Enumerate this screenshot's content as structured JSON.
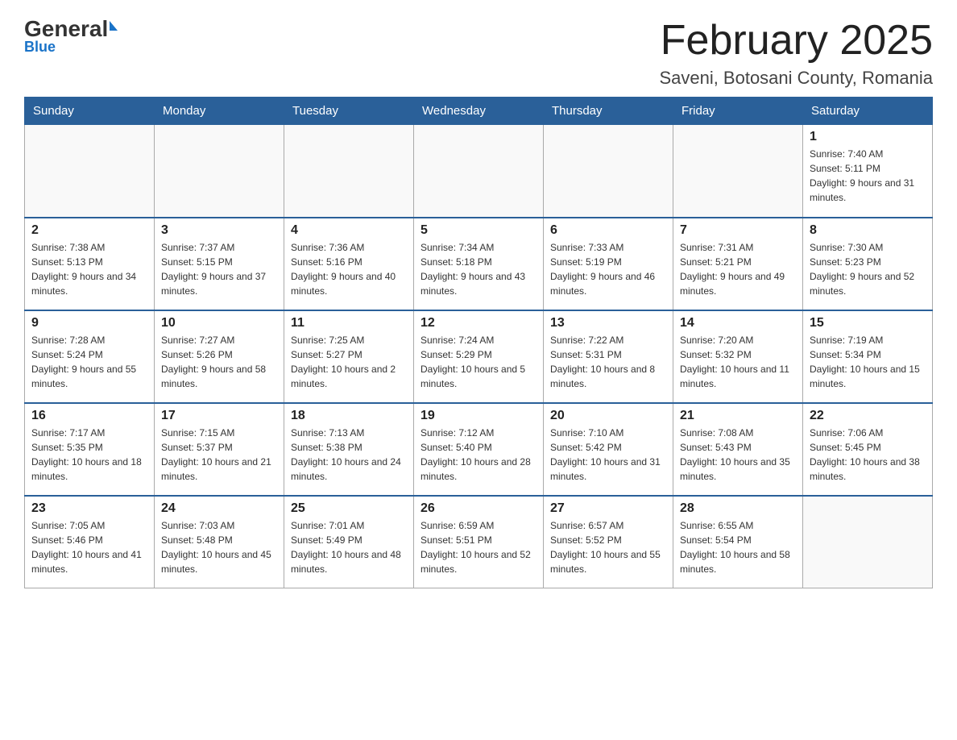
{
  "header": {
    "logo_main": "General",
    "logo_blue": "Blue",
    "month_title": "February 2025",
    "location": "Saveni, Botosani County, Romania"
  },
  "weekdays": [
    "Sunday",
    "Monday",
    "Tuesday",
    "Wednesday",
    "Thursday",
    "Friday",
    "Saturday"
  ],
  "weeks": [
    [
      {
        "day": "",
        "info": ""
      },
      {
        "day": "",
        "info": ""
      },
      {
        "day": "",
        "info": ""
      },
      {
        "day": "",
        "info": ""
      },
      {
        "day": "",
        "info": ""
      },
      {
        "day": "",
        "info": ""
      },
      {
        "day": "1",
        "info": "Sunrise: 7:40 AM\nSunset: 5:11 PM\nDaylight: 9 hours and 31 minutes."
      }
    ],
    [
      {
        "day": "2",
        "info": "Sunrise: 7:38 AM\nSunset: 5:13 PM\nDaylight: 9 hours and 34 minutes."
      },
      {
        "day": "3",
        "info": "Sunrise: 7:37 AM\nSunset: 5:15 PM\nDaylight: 9 hours and 37 minutes."
      },
      {
        "day": "4",
        "info": "Sunrise: 7:36 AM\nSunset: 5:16 PM\nDaylight: 9 hours and 40 minutes."
      },
      {
        "day": "5",
        "info": "Sunrise: 7:34 AM\nSunset: 5:18 PM\nDaylight: 9 hours and 43 minutes."
      },
      {
        "day": "6",
        "info": "Sunrise: 7:33 AM\nSunset: 5:19 PM\nDaylight: 9 hours and 46 minutes."
      },
      {
        "day": "7",
        "info": "Sunrise: 7:31 AM\nSunset: 5:21 PM\nDaylight: 9 hours and 49 minutes."
      },
      {
        "day": "8",
        "info": "Sunrise: 7:30 AM\nSunset: 5:23 PM\nDaylight: 9 hours and 52 minutes."
      }
    ],
    [
      {
        "day": "9",
        "info": "Sunrise: 7:28 AM\nSunset: 5:24 PM\nDaylight: 9 hours and 55 minutes."
      },
      {
        "day": "10",
        "info": "Sunrise: 7:27 AM\nSunset: 5:26 PM\nDaylight: 9 hours and 58 minutes."
      },
      {
        "day": "11",
        "info": "Sunrise: 7:25 AM\nSunset: 5:27 PM\nDaylight: 10 hours and 2 minutes."
      },
      {
        "day": "12",
        "info": "Sunrise: 7:24 AM\nSunset: 5:29 PM\nDaylight: 10 hours and 5 minutes."
      },
      {
        "day": "13",
        "info": "Sunrise: 7:22 AM\nSunset: 5:31 PM\nDaylight: 10 hours and 8 minutes."
      },
      {
        "day": "14",
        "info": "Sunrise: 7:20 AM\nSunset: 5:32 PM\nDaylight: 10 hours and 11 minutes."
      },
      {
        "day": "15",
        "info": "Sunrise: 7:19 AM\nSunset: 5:34 PM\nDaylight: 10 hours and 15 minutes."
      }
    ],
    [
      {
        "day": "16",
        "info": "Sunrise: 7:17 AM\nSunset: 5:35 PM\nDaylight: 10 hours and 18 minutes."
      },
      {
        "day": "17",
        "info": "Sunrise: 7:15 AM\nSunset: 5:37 PM\nDaylight: 10 hours and 21 minutes."
      },
      {
        "day": "18",
        "info": "Sunrise: 7:13 AM\nSunset: 5:38 PM\nDaylight: 10 hours and 24 minutes."
      },
      {
        "day": "19",
        "info": "Sunrise: 7:12 AM\nSunset: 5:40 PM\nDaylight: 10 hours and 28 minutes."
      },
      {
        "day": "20",
        "info": "Sunrise: 7:10 AM\nSunset: 5:42 PM\nDaylight: 10 hours and 31 minutes."
      },
      {
        "day": "21",
        "info": "Sunrise: 7:08 AM\nSunset: 5:43 PM\nDaylight: 10 hours and 35 minutes."
      },
      {
        "day": "22",
        "info": "Sunrise: 7:06 AM\nSunset: 5:45 PM\nDaylight: 10 hours and 38 minutes."
      }
    ],
    [
      {
        "day": "23",
        "info": "Sunrise: 7:05 AM\nSunset: 5:46 PM\nDaylight: 10 hours and 41 minutes."
      },
      {
        "day": "24",
        "info": "Sunrise: 7:03 AM\nSunset: 5:48 PM\nDaylight: 10 hours and 45 minutes."
      },
      {
        "day": "25",
        "info": "Sunrise: 7:01 AM\nSunset: 5:49 PM\nDaylight: 10 hours and 48 minutes."
      },
      {
        "day": "26",
        "info": "Sunrise: 6:59 AM\nSunset: 5:51 PM\nDaylight: 10 hours and 52 minutes."
      },
      {
        "day": "27",
        "info": "Sunrise: 6:57 AM\nSunset: 5:52 PM\nDaylight: 10 hours and 55 minutes."
      },
      {
        "day": "28",
        "info": "Sunrise: 6:55 AM\nSunset: 5:54 PM\nDaylight: 10 hours and 58 minutes."
      },
      {
        "day": "",
        "info": ""
      }
    ]
  ]
}
